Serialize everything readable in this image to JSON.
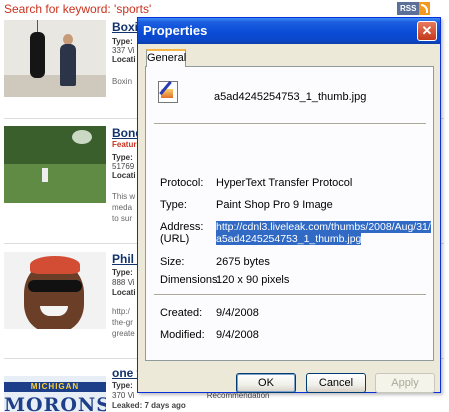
{
  "page": {
    "search_title": "Search for keyword: 'sports'",
    "rss_label": "RSS",
    "results": [
      {
        "title": "Boxi",
        "type_label": "Type:",
        "views": "337 Vi",
        "location_label": "Locati",
        "desc_lines": [
          "Boxin"
        ]
      },
      {
        "title": "Bond",
        "featured": "Featur",
        "type_label": "Type:",
        "views": "51769",
        "location_label": "Locati",
        "desc_lines": [
          "This w",
          "meda",
          "to sur"
        ]
      },
      {
        "title": "Phil J",
        "type_label": "Type:",
        "views": "888 Vi",
        "location_label": "Locati",
        "desc_lines": [
          "http:/",
          "the-gr",
          "greate"
        ]
      },
      {
        "title": "one t",
        "type_label": "Type:",
        "views": "370 Vi",
        "views_suffix": "Recommendation",
        "leaked": "Leaked: 7 days ago",
        "thumb_banner": "MICHIGAN",
        "thumb_text": "MORONS"
      }
    ]
  },
  "dialog": {
    "title": "Properties",
    "close_label": "✕",
    "tab_label": "General",
    "filename": "a5ad4245254753_1_thumb.jpg",
    "protocol_label": "Protocol:",
    "protocol_value": "HyperText Transfer Protocol",
    "type_label": "Type:",
    "type_value": "Paint Shop Pro 9 Image",
    "address_label": "Address:",
    "address_sublabel": "(URL)",
    "address_value": "http://cdnl3.liveleak.com/thumbs/2008/Aug/31/a5ad4245254753_1_thumb.jpg",
    "size_label": "Size:",
    "size_value": "2675 bytes",
    "dimensions_label": "Dimensions:",
    "dimensions_value": "120 x 90 pixels",
    "created_label": "Created:",
    "created_value": "9/4/2008",
    "modified_label": "Modified:",
    "modified_value": "9/4/2008",
    "buttons": {
      "ok": "OK",
      "cancel": "Cancel",
      "apply": "Apply"
    }
  }
}
